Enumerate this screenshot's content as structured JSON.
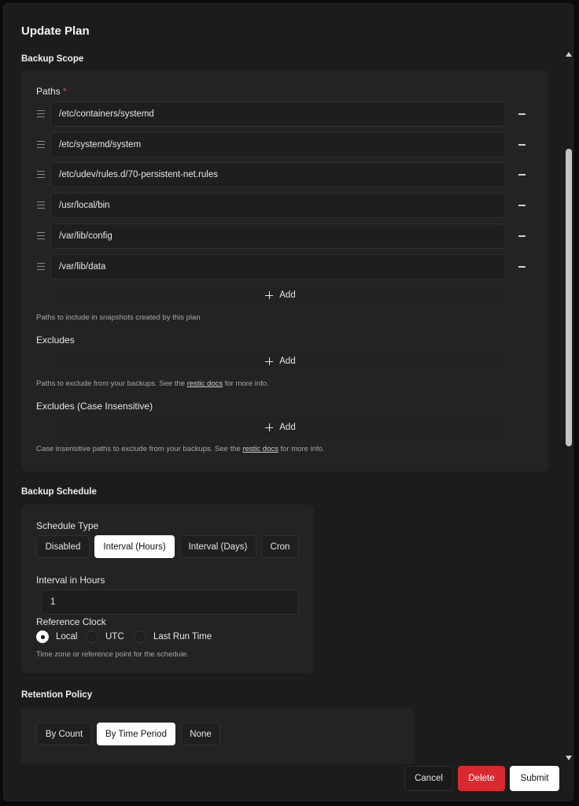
{
  "modal": {
    "title": "Update Plan"
  },
  "backup_scope": {
    "title": "Backup Scope",
    "paths": {
      "label": "Paths",
      "required_mark": "*",
      "items": [
        "/etc/containers/systemd",
        "/etc/systemd/system",
        "/etc/udev/rules.d/70-persistent-net.rules",
        "/usr/local/bin",
        "/var/lib/config",
        "/var/lib/data"
      ],
      "add_label": "Add",
      "help": "Paths to include in snapshots created by this plan"
    },
    "excludes": {
      "label": "Excludes",
      "add_label": "Add",
      "help_prefix": "Paths to exclude from your backups. See the ",
      "help_link": "restic docs",
      "help_suffix": " for more info."
    },
    "iexcludes": {
      "label": "Excludes (Case Insensitive)",
      "add_label": "Add",
      "help_prefix": "Case insensitive paths to exclude from your backups. See the ",
      "help_link": "restic docs",
      "help_suffix": " for more info."
    }
  },
  "backup_schedule": {
    "title": "Backup Schedule",
    "schedule_type_label": "Schedule Type",
    "schedule_options": [
      "Disabled",
      "Interval (Hours)",
      "Interval (Days)",
      "Cron"
    ],
    "selected_option": "Interval (Hours)",
    "interval_label": "Interval in Hours",
    "interval_value": "1",
    "reference_clock_label": "Reference Clock",
    "clock_options": [
      "Local",
      "UTC",
      "Last Run Time"
    ],
    "selected_clock": "Local",
    "clock_help": "Time zone or reference point for the schedule."
  },
  "retention": {
    "title": "Retention Policy",
    "options": [
      "By Count",
      "By Time Period",
      "None"
    ],
    "selected_option": "By Time Period"
  },
  "footer": {
    "cancel": "Cancel",
    "delete": "Delete",
    "submit": "Submit"
  }
}
